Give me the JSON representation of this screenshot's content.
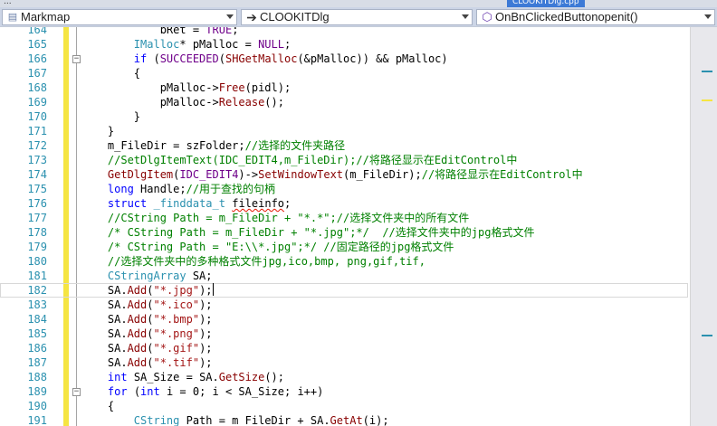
{
  "tabs": {
    "left_fragment": "...",
    "active_tab": "CLOOKITDlg.cpp"
  },
  "navbar": {
    "project": {
      "label": "Markmap",
      "icon": "project-icon"
    },
    "class": {
      "label": "CLOOKITDlg",
      "icon": "arrow-right-icon"
    },
    "member": {
      "label": "OnBnClickedButtonopenit()",
      "icon": "method-cube-icon"
    }
  },
  "colors": {
    "keyword": "#0000ff",
    "type": "#2b91af",
    "macro": "#6f008a",
    "function": "#880000",
    "comment": "#008000",
    "string": "#a31515",
    "line_number": "#2b91af",
    "margin_bar": "#f5e542",
    "navbar_bg": "#ccd5e6"
  },
  "editor": {
    "cursor_line": "182",
    "lines": [
      {
        "num": "164",
        "fold": "",
        "tokens": [
          {
            "t": "            bRet = "
          },
          {
            "t": "TRUE",
            "c": "mac"
          },
          {
            "t": ";"
          }
        ]
      },
      {
        "num": "165",
        "fold": "",
        "tokens": [
          {
            "t": "        "
          },
          {
            "t": "IMalloc",
            "c": "ty"
          },
          {
            "t": "* pMalloc = "
          },
          {
            "t": "NULL",
            "c": "mac"
          },
          {
            "t": ";"
          }
        ]
      },
      {
        "num": "166",
        "fold": "−",
        "tokens": [
          {
            "t": "        "
          },
          {
            "t": "if",
            "c": "kw"
          },
          {
            "t": " ("
          },
          {
            "t": "SUCCEEDED",
            "c": "mac"
          },
          {
            "t": "("
          },
          {
            "t": "SHGetMalloc",
            "c": "fn"
          },
          {
            "t": "(&pMalloc)) && pMalloc)"
          }
        ]
      },
      {
        "num": "167",
        "fold": "",
        "tokens": [
          {
            "t": "        {"
          }
        ]
      },
      {
        "num": "168",
        "fold": "",
        "tokens": [
          {
            "t": "            pMalloc->"
          },
          {
            "t": "Free",
            "c": "fn"
          },
          {
            "t": "(pidl);"
          }
        ]
      },
      {
        "num": "169",
        "fold": "",
        "tokens": [
          {
            "t": "            pMalloc->"
          },
          {
            "t": "Release",
            "c": "fn"
          },
          {
            "t": "();"
          }
        ]
      },
      {
        "num": "170",
        "fold": "",
        "tokens": [
          {
            "t": "        }"
          }
        ]
      },
      {
        "num": "171",
        "fold": "",
        "tokens": [
          {
            "t": "    }"
          }
        ]
      },
      {
        "num": "172",
        "fold": "",
        "tokens": [
          {
            "t": "    m_FileDir = szFolder;"
          },
          {
            "t": "//选择的文件夹路径",
            "c": "cm"
          }
        ]
      },
      {
        "num": "173",
        "fold": "",
        "tokens": [
          {
            "t": "    //SetDlgItemText(IDC_EDIT4,m_FileDir);//将路径显示在EditControl中",
            "c": "cm"
          }
        ]
      },
      {
        "num": "174",
        "fold": "",
        "tokens": [
          {
            "t": "    "
          },
          {
            "t": "GetDlgItem",
            "c": "fn"
          },
          {
            "t": "("
          },
          {
            "t": "IDC_EDIT4",
            "c": "mac"
          },
          {
            "t": ")->"
          },
          {
            "t": "SetWindowText",
            "c": "fn"
          },
          {
            "t": "(m_FileDir);"
          },
          {
            "t": "//将路径显示在EditControl中",
            "c": "cm"
          }
        ]
      },
      {
        "num": "175",
        "fold": "",
        "tokens": [
          {
            "t": "    "
          },
          {
            "t": "long",
            "c": "kw"
          },
          {
            "t": " Handle;"
          },
          {
            "t": "//用于查找的句柄",
            "c": "cm"
          }
        ]
      },
      {
        "num": "176",
        "fold": "",
        "tokens": [
          {
            "t": "    "
          },
          {
            "t": "struct",
            "c": "kw"
          },
          {
            "t": " "
          },
          {
            "t": "_finddata_t",
            "c": "ty"
          },
          {
            "t": " "
          },
          {
            "t": "fileinfo",
            "c": "squig"
          },
          {
            "t": ";"
          }
        ]
      },
      {
        "num": "177",
        "fold": "",
        "tokens": [
          {
            "t": "    //CString Path = m_FileDir + \"*.*\";//选择文件夹中的所有文件",
            "c": "cm"
          }
        ]
      },
      {
        "num": "178",
        "fold": "",
        "tokens": [
          {
            "t": "    /* CString Path = m_FileDir + \"*.jpg\";*/  //选择文件夹中的jpg格式文件",
            "c": "cm"
          }
        ]
      },
      {
        "num": "179",
        "fold": "",
        "tokens": [
          {
            "t": "    /* CString Path = \"E:\\\\*.jpg\";*/ //固定路径的jpg格式文件",
            "c": "cm"
          }
        ]
      },
      {
        "num": "180",
        "fold": "",
        "tokens": [
          {
            "t": "    //选择文件夹中的多种格式文件jpg,ico,bmp, png,gif,tif,",
            "c": "cm"
          }
        ]
      },
      {
        "num": "181",
        "fold": "",
        "tokens": [
          {
            "t": "    "
          },
          {
            "t": "CStringArray",
            "c": "ty"
          },
          {
            "t": " SA;"
          }
        ]
      },
      {
        "num": "182",
        "fold": "",
        "tokens": [
          {
            "t": "    SA."
          },
          {
            "t": "Add",
            "c": "fn"
          },
          {
            "t": "("
          },
          {
            "t": "\"*.jpg\"",
            "c": "st"
          },
          {
            "t": ");"
          }
        ]
      },
      {
        "num": "183",
        "fold": "",
        "tokens": [
          {
            "t": "    SA."
          },
          {
            "t": "Add",
            "c": "fn"
          },
          {
            "t": "("
          },
          {
            "t": "\"*.ico\"",
            "c": "st"
          },
          {
            "t": ");"
          }
        ]
      },
      {
        "num": "184",
        "fold": "",
        "tokens": [
          {
            "t": "    SA."
          },
          {
            "t": "Add",
            "c": "fn"
          },
          {
            "t": "("
          },
          {
            "t": "\"*.bmp\"",
            "c": "st"
          },
          {
            "t": ");"
          }
        ]
      },
      {
        "num": "185",
        "fold": "",
        "tokens": [
          {
            "t": "    SA."
          },
          {
            "t": "Add",
            "c": "fn"
          },
          {
            "t": "("
          },
          {
            "t": "\"*.png\"",
            "c": "st"
          },
          {
            "t": ");"
          }
        ]
      },
      {
        "num": "186",
        "fold": "",
        "tokens": [
          {
            "t": "    SA."
          },
          {
            "t": "Add",
            "c": "fn"
          },
          {
            "t": "("
          },
          {
            "t": "\"*.gif\"",
            "c": "st"
          },
          {
            "t": ");"
          }
        ]
      },
      {
        "num": "187",
        "fold": "",
        "tokens": [
          {
            "t": "    SA."
          },
          {
            "t": "Add",
            "c": "fn"
          },
          {
            "t": "("
          },
          {
            "t": "\"*.tif\"",
            "c": "st"
          },
          {
            "t": ");"
          }
        ]
      },
      {
        "num": "188",
        "fold": "",
        "tokens": [
          {
            "t": "    "
          },
          {
            "t": "int",
            "c": "kw"
          },
          {
            "t": " SA_Size = SA."
          },
          {
            "t": "GetSize",
            "c": "fn"
          },
          {
            "t": "();"
          }
        ]
      },
      {
        "num": "189",
        "fold": "−",
        "tokens": [
          {
            "t": "    "
          },
          {
            "t": "for",
            "c": "kw"
          },
          {
            "t": " ("
          },
          {
            "t": "int",
            "c": "kw"
          },
          {
            "t": " i = 0; i < SA_Size; i++)"
          }
        ]
      },
      {
        "num": "190",
        "fold": "",
        "tokens": [
          {
            "t": "    {"
          }
        ]
      },
      {
        "num": "191",
        "fold": "",
        "tokens": [
          {
            "t": "        "
          },
          {
            "t": "CString",
            "c": "ty"
          },
          {
            "t": " Path = m_FileDir + SA."
          },
          {
            "t": "GetAt",
            "c": "fn"
          },
          {
            "t": "(i);"
          }
        ]
      }
    ]
  }
}
